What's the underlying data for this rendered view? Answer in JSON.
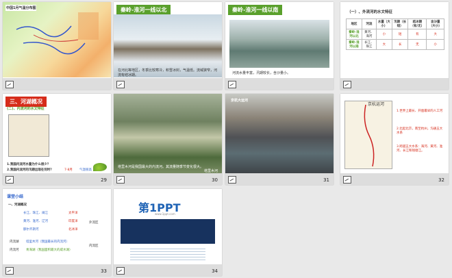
{
  "slides": [
    {
      "page": "",
      "title": "中国1月气温分布图"
    },
    {
      "page": "",
      "title": "秦岭-淮河一线以北",
      "caption": "在河北等地区，冬季比较寒冷，积雪冰封，气温低。流域狭窄，河流有结冰期。"
    },
    {
      "page": "",
      "title": "秦岭-淮河一线以南",
      "caption": "河流水量丰富，汛期较长，含沙量小。"
    },
    {
      "page": "",
      "title": "（一）、外流河的水文特征",
      "table_headers": [
        "地区",
        "河流",
        "水量（大小）",
        "汛期（长短）",
        "结冰期（有/无）",
        "含沙量（大小）"
      ],
      "table_rows": [
        [
          "秦岭-淮河以北",
          "黄河、海河",
          "小",
          "短",
          "有",
          "大"
        ],
        [
          "秦岭-淮河以南",
          "长江、珠江",
          "大",
          "长",
          "无",
          "小"
        ]
      ]
    },
    {
      "page": "29",
      "title": "三、河湖概况",
      "subtitle": "(二)、内流河的水文特征",
      "q1": "1.我国内流河水量为什么很少？",
      "q2": "2.我国内流河的汛期出现在何时？",
      "a2": "7-8月",
      "note": "气温很高"
    },
    {
      "page": "30",
      "caption": "塔里木河是我国最大的内流河。其流量随季节变化很大。",
      "label": "塔里木河"
    },
    {
      "page": "31",
      "label": "京杭大运河"
    },
    {
      "page": "32",
      "title": "京杭运河",
      "points": [
        "1.世界上最长、开凿最早的人工河",
        "2.北起北京，南至杭州，沟通五大水系",
        "3.跨越五大水系：海河、黄河、淮河、长江和钱塘江。"
      ]
    },
    {
      "page": "33",
      "title": "课堂小结",
      "section": "一、河湖概况",
      "rivers": [
        "长江、珠江、闽江",
        "黄河、淮河、辽河",
        "额尔齐斯河"
      ],
      "oceans": [
        "太平洋",
        "印度洋",
        "北冰洋"
      ],
      "external": "外流区",
      "inner_lake": "内流湖",
      "inner_lake_name": "塔里木河（我国最长的内流河）",
      "inner_river": "内流河",
      "inner_river_name": "青海湖（我国面积最大的咸水湖）",
      "internal": "内流区"
    },
    {
      "page": "34",
      "logo": "第1PPT",
      "logo_sub": "www.1ppt.com"
    }
  ]
}
